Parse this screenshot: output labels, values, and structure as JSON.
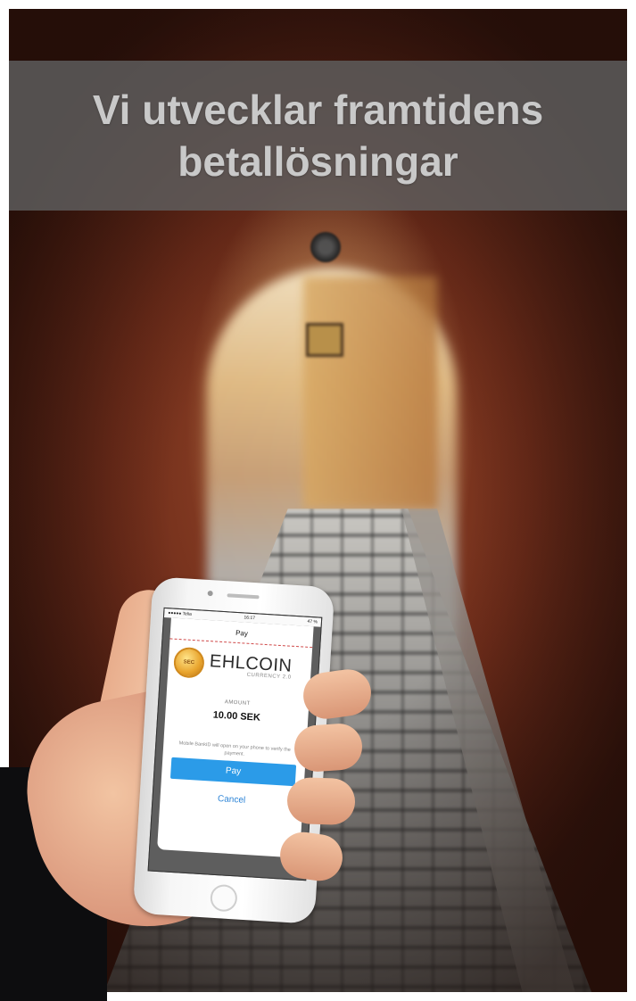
{
  "headline": {
    "line1": "Vi utvecklar framtidens",
    "line2": "betallösningar"
  },
  "phone": {
    "status_left": "●●●●● Telia",
    "status_time": "16:17",
    "status_right": "47 %",
    "sheet_title": "Pay",
    "coin_label": "SEC",
    "brand_name": "EHLCOIN",
    "brand_sub": "CURRENCY 2.0",
    "amount_label": "AMOUNT",
    "amount_value": "10.00 SEK",
    "info_text": "Mobile BankID will open on your phone to verify the payment.",
    "pay_label": "Pay",
    "cancel_label": "Cancel"
  },
  "colors": {
    "banner_bg": "#5f5f5f",
    "headline_text": "#c9c9c9",
    "pay_button": "#2b9be8",
    "cancel_text": "#2b83d6",
    "coin_gold": "#e8a32c"
  }
}
